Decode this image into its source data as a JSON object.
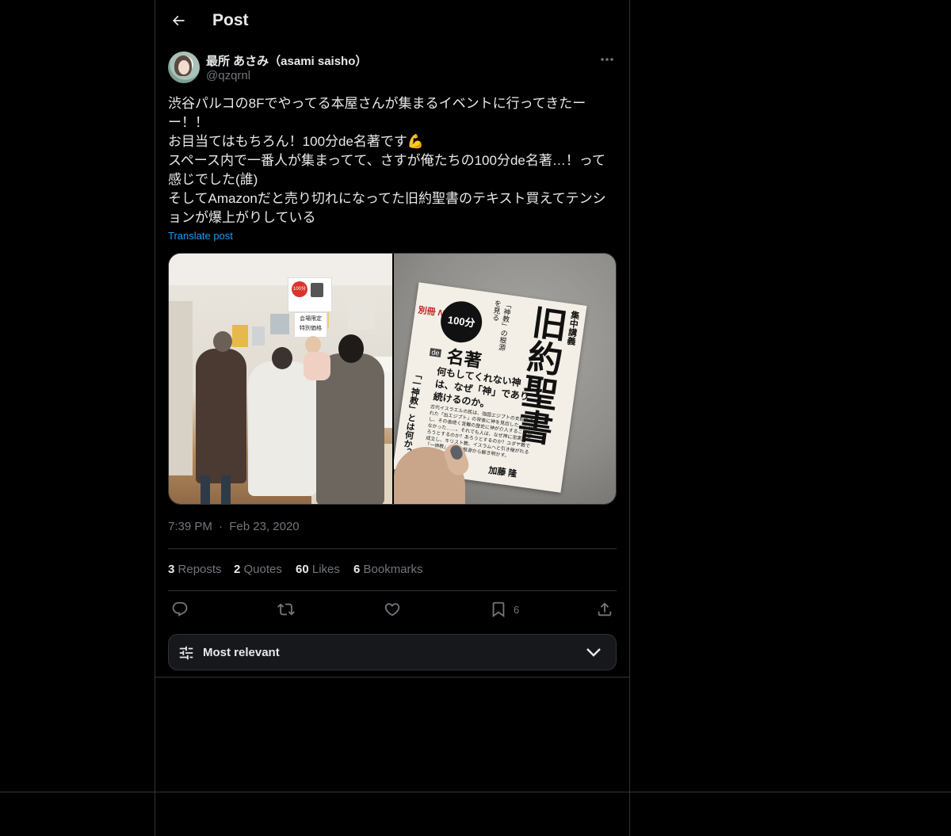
{
  "header": {
    "title": "Post",
    "back_icon": "arrow-left-icon"
  },
  "author": {
    "display_name": "最所 あさみ（asami saisho）",
    "handle": "@qzqrnl"
  },
  "tweet": {
    "text": "渋谷パルコの8Fでやってる本屋さんが集まるイベントに行ってきたーー！！\nお目当てはもちろん！100分de名著です💪\nスペース内で一番人が集まってて、さすが俺たちの100分de名著…！って感じでした(誰)\nそしてAmazonだと売り切れになってた旧約聖書のテキスト買えてテンションが爆上がりしている",
    "translate_label": "Translate post",
    "time": "7:39 PM",
    "separator": "·",
    "date": "Feb 23, 2020"
  },
  "media": {
    "photo1_signs": [
      "100分de名著",
      "会場限定",
      "特別価格"
    ],
    "book": {
      "title": "旧約聖書",
      "series": "集中講義",
      "brand_nhk": "NHK",
      "brand_bessatsu": "別冊",
      "label_100": "100分",
      "label_meicho": "名著",
      "label_de": "de",
      "subtitle_side": "「神教」の根源を見る",
      "tagline": "何もしてくれない神は、なぜ「神」であり続けるのか。",
      "spine_text": "「一神教」とは何か？",
      "body_text": "古代イスラエルの民は、強国エジプトの支配を逃れた「出エジプト」の背後に神を見出した。しかし、その後続く苦難の歴史に神が介入することはなかった……。それでも人は、なぜ神に忠実であろうとするのか？あろうとするのか？ユダヤ教で成立し、キリスト教、イスラムへと引き継がれる「一神教」の謎を根源から解き明かす。",
      "author_name": "加藤 隆"
    }
  },
  "stats": {
    "reposts": {
      "count": "3",
      "label": "Reposts"
    },
    "quotes": {
      "count": "2",
      "label": "Quotes"
    },
    "likes": {
      "count": "60",
      "label": "Likes"
    },
    "bookmarks": {
      "count": "6",
      "label": "Bookmarks"
    }
  },
  "actions": {
    "bookmark_count": "6"
  },
  "sort": {
    "label": "Most relevant"
  },
  "colors": {
    "background": "#000000",
    "border": "#2f3336",
    "accent": "#1d9bf0",
    "muted": "#71767b",
    "text": "#e7e9ea"
  }
}
